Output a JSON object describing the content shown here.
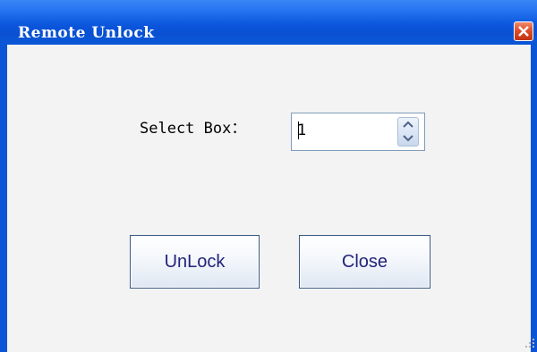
{
  "window": {
    "title": "Remote Unlock",
    "close_icon": "close-icon"
  },
  "form": {
    "label": "Select Box：",
    "box_value": "1"
  },
  "buttons": {
    "unlock_label": "UnLock",
    "close_label": "Close"
  },
  "colors": {
    "titlebar": "#0a55d6",
    "client_bg": "#f3f3f3",
    "close_button": "#dd4a25",
    "button_text": "#23237a"
  }
}
